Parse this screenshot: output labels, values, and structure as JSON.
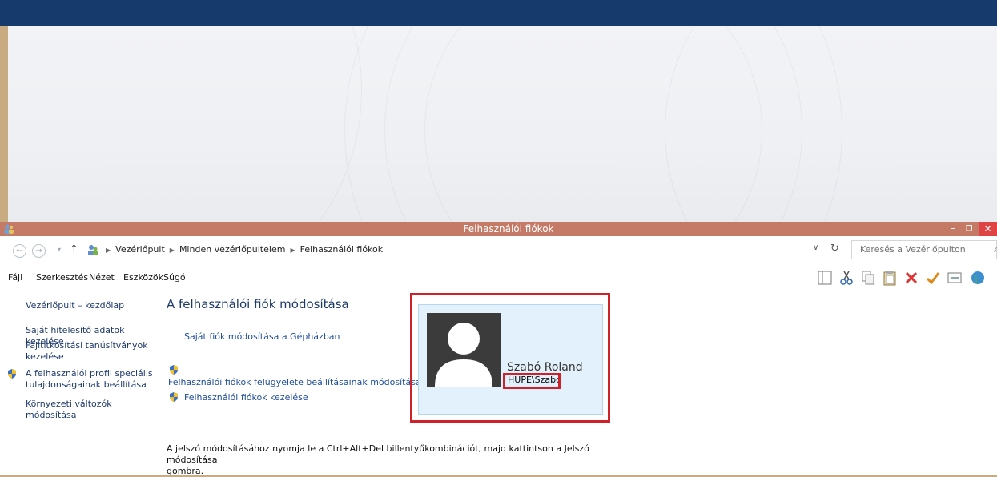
{
  "window": {
    "title": "Felhasználói fiókok",
    "minimize_label": "–",
    "maximize_label": "❐",
    "close_label": "✕"
  },
  "addressbar": {
    "back_label": "←",
    "forward_label": "→",
    "history_label": "▾",
    "up_label": "↑",
    "crumbs": [
      "Vezérlőpult",
      "Minden vezérlőpultelem",
      "Felhasználói fiókok"
    ],
    "dropdown_label": "∨",
    "refresh_label": "↻",
    "search_placeholder": "Keresés a Vezérlőpulton",
    "search_icon_label": "⌕"
  },
  "menubar": {
    "items": [
      "Fájl",
      "Szerkesztés",
      "Nézet",
      "Eszközök",
      "Súgó"
    ]
  },
  "toolbar": {
    "icons": [
      "panes-icon",
      "cut-icon",
      "copy-icon",
      "paste-icon",
      "delete-icon",
      "properties-check-icon",
      "window-icon",
      "globe-icon"
    ]
  },
  "sidebar": {
    "home": "Vezérlőpult – kezdőlap",
    "items": [
      {
        "line1": "Saját hitelesítő adatok kezelése",
        "line2": ""
      },
      {
        "line1": "Fájltitkosítási tanúsítványok",
        "line2": "kezelése"
      },
      {
        "line1": "A felhasználói profil speciális",
        "line2": "tulajdonságainak beállítása"
      },
      {
        "line1": "Környezeti változók",
        "line2": "módosítása"
      }
    ]
  },
  "main": {
    "heading": "A felhasználói fiók módosítása",
    "link_own_account": "Saját fiók módosítása a Gépházban",
    "link_uac": "Felhasználói fiókok felügyelete beállításainak módosítása",
    "link_manage": "Felhasználói fiókok kezelése",
    "description_line1": "A jelszó módosításához nyomja le a Ctrl+Alt+Del billentyűkombinációt, majd kattintson a Jelszó módosítása",
    "description_line2": "gombra."
  },
  "user": {
    "name": "Szabó Roland",
    "account": "HUPE\\Szabo"
  },
  "colors": {
    "titlebar": "#c47a66",
    "topbar": "#163a6b",
    "highlight": "#d0202a",
    "link": "#1e4d9b"
  }
}
